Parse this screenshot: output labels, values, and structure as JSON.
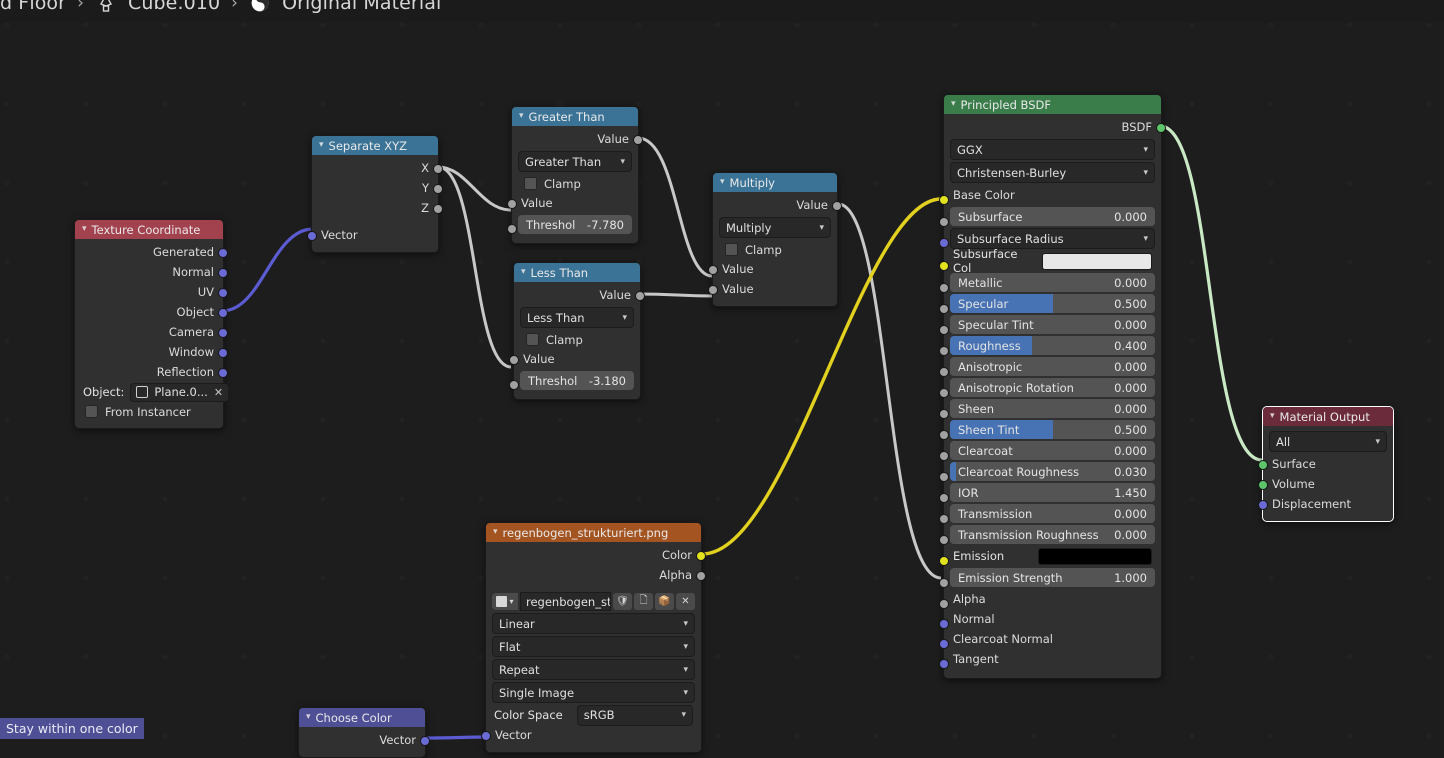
{
  "app": {
    "editor": "blender-shader-node-editor",
    "background_color": "#1d1d1d"
  },
  "breadcrumb": {
    "items": [
      {
        "label": "d Floor",
        "icon": "object-icon"
      },
      {
        "label": "Cube.010",
        "icon": "light-icon"
      },
      {
        "label": "Original Material",
        "icon": "material-sphere-icon"
      }
    ],
    "separator": "›"
  },
  "frame": {
    "label": "Stay within one color",
    "color": "#4f4f96"
  },
  "colors": {
    "header_texture_coordinate": "#a3424f",
    "header_converter": "#3a7396",
    "header_shader": "#3a7d4b",
    "header_output": "#6b2b3a",
    "header_image": "#a35420",
    "header_group": "#4f4f96",
    "socket_vector": "#6b6bd6",
    "socket_value": "#a1a1a1",
    "socket_color": "#e2e21f",
    "socket_shader": "#5ec46b",
    "slider_fill": "#4772b3",
    "link_gray": "#c8c8c8",
    "link_yellow": "#e2d11f",
    "link_purple": "#5b5bd2",
    "link_green": "#c9e8c4"
  },
  "nodes": {
    "texture_coordinate": {
      "title": "Texture Coordinate",
      "outputs": [
        "Generated",
        "Normal",
        "UV",
        "Object",
        "Camera",
        "Window",
        "Reflection"
      ],
      "object_label": "Object:",
      "object_value": "Plane.0...",
      "from_instancer_label": "From Instancer"
    },
    "separate_xyz": {
      "title": "Separate XYZ",
      "outputs": [
        "X",
        "Y",
        "Z"
      ],
      "inputs": [
        "Vector"
      ]
    },
    "greater_than": {
      "title": "Greater Than",
      "output_label": "Value",
      "operation": "Greater Than",
      "clamp_label": "Clamp",
      "input_label": "Value",
      "threshold_name": "Threshol",
      "threshold_value": "-7.780"
    },
    "less_than": {
      "title": "Less Than",
      "output_label": "Value",
      "operation": "Less Than",
      "clamp_label": "Clamp",
      "input_label": "Value",
      "threshold_name": "Threshol",
      "threshold_value": "-3.180"
    },
    "multiply": {
      "title": "Multiply",
      "output_label": "Value",
      "operation": "Multiply",
      "clamp_label": "Clamp",
      "input_a": "Value",
      "input_b": "Value"
    },
    "principled_bsdf": {
      "title": "Principled BSDF",
      "output_label": "BSDF",
      "distribution": "GGX",
      "subsurface_method": "Christensen-Burley",
      "subsurface_radius_label": "Subsurface Radius",
      "subsurface_col_label": "Subsurface Col",
      "subsurface_col_value": "#e8e8e8",
      "emission_color_value": "#000000",
      "inputs": [
        {
          "name": "Base Color",
          "type": "color",
          "socket": "color"
        },
        {
          "name": "Subsurface",
          "type": "slider",
          "value": "0.000",
          "fill": 0,
          "socket": "value"
        },
        {
          "name": "Subsurface Radius",
          "type": "select",
          "socket": "vector"
        },
        {
          "name": "Subsurface Col",
          "type": "swatch",
          "swatch": "#e8e8e8",
          "socket": "color"
        },
        {
          "name": "Metallic",
          "type": "slider",
          "value": "0.000",
          "fill": 0,
          "socket": "value"
        },
        {
          "name": "Specular",
          "type": "slider",
          "value": "0.500",
          "fill": 50,
          "socket": "value"
        },
        {
          "name": "Specular Tint",
          "type": "slider",
          "value": "0.000",
          "fill": 0,
          "socket": "value"
        },
        {
          "name": "Roughness",
          "type": "slider",
          "value": "0.400",
          "fill": 40,
          "socket": "value"
        },
        {
          "name": "Anisotropic",
          "type": "slider",
          "value": "0.000",
          "fill": 0,
          "socket": "value"
        },
        {
          "name": "Anisotropic Rotation",
          "type": "slider",
          "value": "0.000",
          "fill": 0,
          "socket": "value"
        },
        {
          "name": "Sheen",
          "type": "slider",
          "value": "0.000",
          "fill": 0,
          "socket": "value"
        },
        {
          "name": "Sheen Tint",
          "type": "slider",
          "value": "0.500",
          "fill": 50,
          "socket": "value"
        },
        {
          "name": "Clearcoat",
          "type": "slider",
          "value": "0.000",
          "fill": 0,
          "socket": "value"
        },
        {
          "name": "Clearcoat Roughness",
          "type": "slider",
          "value": "0.030",
          "fill": 3,
          "socket": "value"
        },
        {
          "name": "IOR",
          "type": "slider",
          "value": "1.450",
          "fill": 0,
          "socket": "value"
        },
        {
          "name": "Transmission",
          "type": "slider",
          "value": "0.000",
          "fill": 0,
          "socket": "value"
        },
        {
          "name": "Transmission Roughness",
          "type": "slider",
          "value": "0.000",
          "fill": 0,
          "socket": "value"
        },
        {
          "name": "Emission",
          "type": "swatch",
          "swatch": "#000000",
          "socket": "color"
        },
        {
          "name": "Emission Strength",
          "type": "slider",
          "value": "1.000",
          "fill": 0,
          "socket": "value"
        },
        {
          "name": "Alpha",
          "type": "plain",
          "socket": "value"
        },
        {
          "name": "Normal",
          "type": "plain",
          "socket": "vector"
        },
        {
          "name": "Clearcoat Normal",
          "type": "plain",
          "socket": "vector"
        },
        {
          "name": "Tangent",
          "type": "plain",
          "socket": "vector"
        }
      ]
    },
    "material_output": {
      "title": "Material Output",
      "target": "All",
      "inputs": [
        "Surface",
        "Volume",
        "Displacement"
      ]
    },
    "image_texture": {
      "title": "regenbogen_strukturiert.png",
      "outputs": [
        "Color",
        "Alpha"
      ],
      "datablock_name": "regenbogen_stru...",
      "datablock_buttons": [
        "shield-icon",
        "copy-icon",
        "pack-icon",
        "close-icon"
      ],
      "interpolation": "Linear",
      "projection": "Flat",
      "extension": "Repeat",
      "source": "Single Image",
      "color_space_label": "Color Space",
      "color_space_value": "sRGB",
      "input_label": "Vector"
    },
    "choose_color": {
      "title": "Choose Color",
      "outputs": [
        "Vector"
      ]
    }
  }
}
